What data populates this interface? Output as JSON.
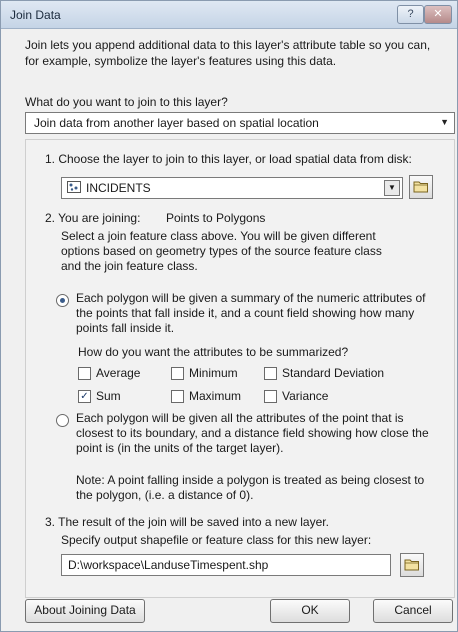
{
  "window": {
    "title": "Join Data",
    "help_label": "?",
    "close_label": "✕"
  },
  "intro": {
    "line1": "Join lets you append additional data to this layer's attribute table so you can,",
    "line2": "for example, symbolize the layer's features using this data."
  },
  "question": "What do you want to join to this layer?",
  "join_type": {
    "value": "Join data from another layer based on spatial location"
  },
  "step1": {
    "label": "1.  Choose the layer to join to this layer, or load spatial data from disk:",
    "layer_value": "INCIDENTS"
  },
  "step2": {
    "label": "2.  You are joining:",
    "joining_value": "Points to Polygons",
    "desc_line1": "Select a join feature class above.  You will be given different",
    "desc_line2": "options based on geometry types of the source feature class",
    "desc_line3": "and the join feature class.",
    "option1": {
      "line1": "Each polygon will be given a summary of the numeric attributes of",
      "line2": "the points that fall inside it, and a count field showing how many",
      "line3": "points fall inside it.",
      "selected": true
    },
    "summary_question": "How do you want the attributes to be summarized?",
    "stats": [
      {
        "label": "Average",
        "checked": false
      },
      {
        "label": "Minimum",
        "checked": false
      },
      {
        "label": "Standard Deviation",
        "checked": false
      },
      {
        "label": "Sum",
        "checked": true
      },
      {
        "label": "Maximum",
        "checked": false
      },
      {
        "label": "Variance",
        "checked": false
      }
    ],
    "option2": {
      "line1": "Each polygon will be given all the attributes of the point that is",
      "line2": "closest to its boundary, and a distance field showing how close the",
      "line3": "point is (in the units of the target layer).",
      "selected": false
    },
    "note_line1": "Note: A point falling inside a polygon is treated as being closest to",
    "note_line2": "the polygon, (i.e. a distance of 0)."
  },
  "step3": {
    "label": "3.  The result of the join will be saved into a new layer.",
    "sub_label": "Specify output shapefile or feature class for this new layer:",
    "output_path": "D:\\workspace\\LanduseTimespent.shp"
  },
  "buttons": {
    "about": "About Joining Data",
    "ok": "OK",
    "cancel": "Cancel"
  }
}
